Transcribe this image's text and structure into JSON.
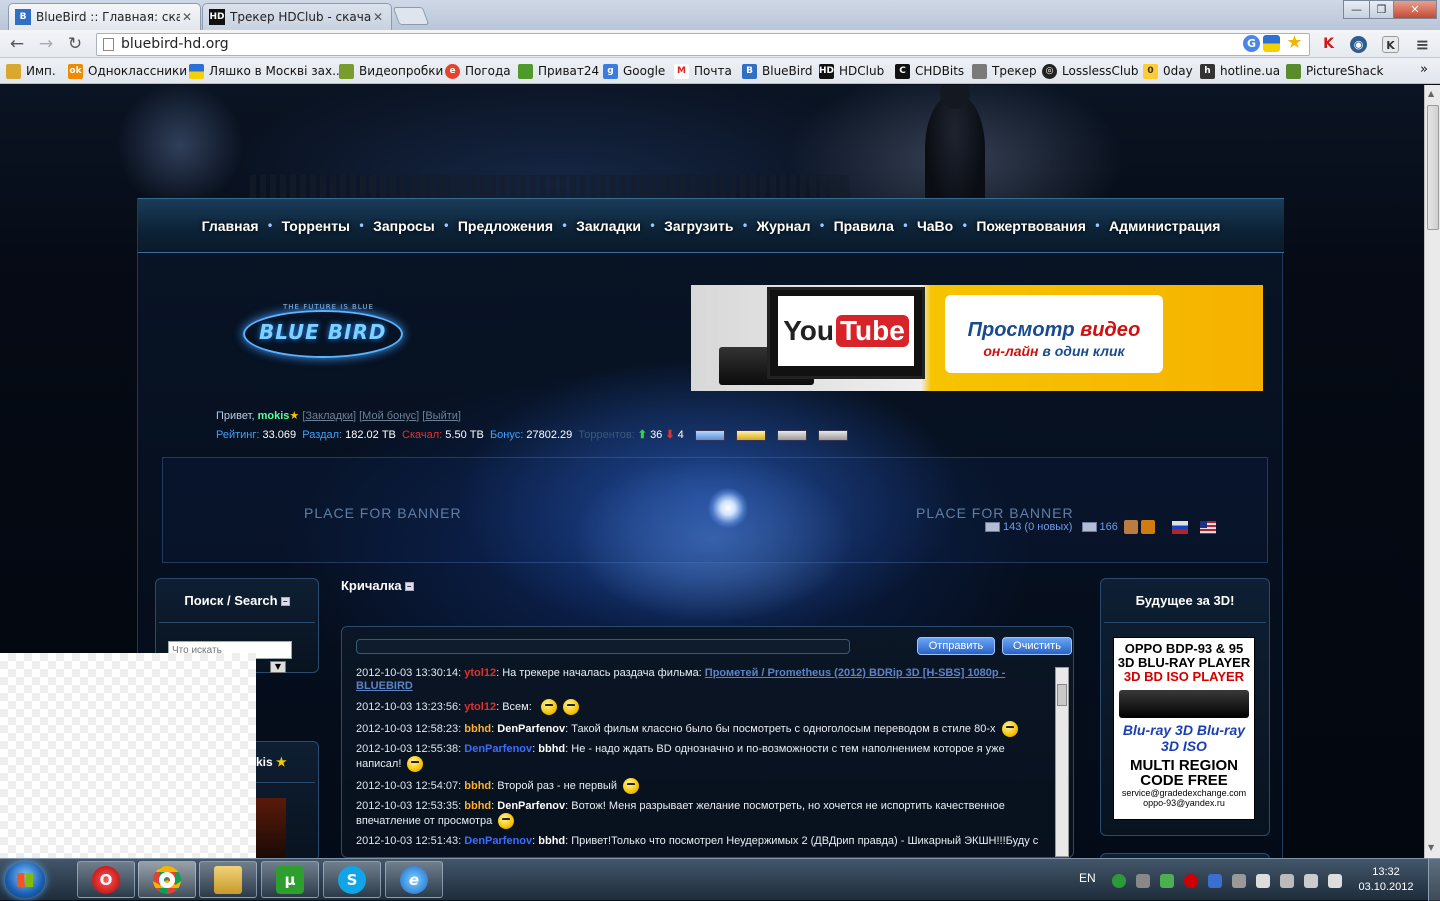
{
  "browser": {
    "tabs": [
      {
        "title": "BlueBird :: Главная: скачат",
        "favicon": "bluebird-icon",
        "active": true
      },
      {
        "title": "Трекер HDClub - скачать",
        "favicon": "hdclub-icon",
        "active": false
      }
    ],
    "url": "bluebird-hd.org",
    "bookmarks": [
      {
        "label": "Имп.",
        "icon": "folder-icon"
      },
      {
        "label": "Одноклассники",
        "icon": "odnoklassniki-icon"
      },
      {
        "label": "Ляшко в Москві зах...",
        "icon": "flag-icon"
      },
      {
        "label": "Видеопробки",
        "icon": "videoprobki-icon"
      },
      {
        "label": "Погода",
        "icon": "weather-icon"
      },
      {
        "label": "Приват24",
        "icon": "privat24-icon"
      },
      {
        "label": "Google",
        "icon": "google-icon"
      },
      {
        "label": "Почта",
        "icon": "mail-icon"
      },
      {
        "label": "BlueBird",
        "icon": "bluebird-icon"
      },
      {
        "label": "HDClub",
        "icon": "hdclub-icon"
      },
      {
        "label": "CHDBits",
        "icon": "chdbits-icon"
      },
      {
        "label": "Трекер",
        "icon": "tracker-icon"
      },
      {
        "label": "LosslessClub",
        "icon": "losslessclub-icon"
      },
      {
        "label": "0day",
        "icon": "zeroday-icon"
      },
      {
        "label": "hotline.ua",
        "icon": "hotline-icon"
      },
      {
        "label": "PictureShack",
        "icon": "pictureshack-icon"
      }
    ]
  },
  "site": {
    "menu": [
      "Главная",
      "Торренты",
      "Запросы",
      "Предложения",
      "Закладки",
      "Загрузить",
      "Журнал",
      "Правила",
      "ЧаВо",
      "Пожертвования",
      "Администрация"
    ],
    "logo_text": "BLUE BIRD",
    "logo_tagline": "THE FUTURE IS BLUE",
    "ad": {
      "you": "You",
      "tube": "Tube",
      "line1_a": "Просмотр ",
      "line1_b": "видео",
      "line2_a": "он-лайн ",
      "line2_b": "в один клик"
    },
    "user": {
      "greeting": "Привет, ",
      "name": "mokis",
      "links": [
        "Закладки",
        "Мой бонус",
        "Выйти"
      ],
      "rating_label": "Рейтинг:",
      "rating": "33.069",
      "uploaded_label": "Раздал:",
      "uploaded": "182.02 TB",
      "downloaded_label": "Скачал:",
      "downloaded": "5.50 TB",
      "bonus_label": "Бонус:",
      "bonus": "27802.29",
      "torrents_label": "Торрентов:",
      "seeding": "36",
      "leeching": "4"
    },
    "messages": {
      "inbox": "143 (0 новых)",
      "outbox": "166"
    },
    "banner_placeholder_left": "PLACE FOR BANNER",
    "banner_placeholder_right": "PLACE FOR BANNER",
    "search_panel": {
      "title": "Поиск / Search",
      "placeholder": "Что искать"
    },
    "user_panel": {
      "title": "kis"
    },
    "shout": {
      "title": "Кричалка",
      "send": "Отправить",
      "clear": "Очистить",
      "messages": [
        {
          "ts": "2012-10-03 13:30:14:",
          "user": "ytol12",
          "ucls": "u-red",
          "pre": "На трекере началась раздача фильма: ",
          "link": "Прометей / Prometheus (2012) BDRip 3D [H-SBS] 1080p - BLUEBIRD",
          "post": "",
          "smiles": 0
        },
        {
          "ts": "2012-10-03 13:23:56:",
          "user": "ytol12",
          "ucls": "u-red",
          "pre": "Всем: ",
          "link": "",
          "post": "",
          "smiles": 2
        },
        {
          "ts": "2012-10-03 12:58:23:",
          "user": "bbhd",
          "ucls": "u-org",
          "to": "DenParfenov",
          "tcls": "u-wht",
          "pre": "Такой фильм классно было бы посмотреть с одноголосым переводом в стиле 80-х",
          "link": "",
          "post": "",
          "smiles": 1
        },
        {
          "ts": "2012-10-03 12:55:38:",
          "user": "DenParfenov",
          "ucls": "u-blue",
          "to": "bbhd",
          "tcls": "u-wht",
          "pre": "Не - надо ждать BD однозначно и по-возможности с тем наполнением которое я уже написал!",
          "link": "",
          "post": "",
          "smiles": 1
        },
        {
          "ts": "2012-10-03 12:54:07:",
          "user": "bbhd",
          "ucls": "u-org",
          "pre": "Второй раз - не первый",
          "link": "",
          "post": "",
          "smiles": 1
        },
        {
          "ts": "2012-10-03 12:53:35:",
          "user": "bbhd",
          "ucls": "u-org",
          "to": "DenParfenov",
          "tcls": "u-wht",
          "pre": "Вотож! Меня разрывает желание посмотреть, но хочется не испортить качественное впечатление от просмотра",
          "link": "",
          "post": "",
          "smiles": 1
        },
        {
          "ts": "2012-10-03 12:51:43:",
          "user": "DenParfenov",
          "ucls": "u-blue",
          "to": "bbhd",
          "tcls": "u-wht",
          "pre": "Привет!Только что посмотрел Неудержимых 2 (ДВДрип правда) - Шикарный ЭКШН!!!Буду с",
          "link": "",
          "post": "",
          "smiles": 0
        }
      ]
    },
    "right_panel": {
      "title": "Будущее за 3D!",
      "ad_lines": [
        "OPPO BDP-93 & 95",
        "3D BLU-RAY PLAYER",
        "3D BD ISO PLAYER",
        "MULTI REGION",
        "CODE FREE",
        "service@gradedexchange.com",
        "oppo-93@yandex.ru"
      ],
      "logos": "Blu-ray 3D  Blu-ray 3D ISO"
    }
  },
  "taskbar": {
    "apps": [
      "opera-icon",
      "chrome-icon",
      "explorer-icon",
      "utorrent-icon",
      "skype-icon",
      "ie-icon"
    ],
    "lang": "EN",
    "time": "13:32",
    "date": "03.10.2012"
  }
}
